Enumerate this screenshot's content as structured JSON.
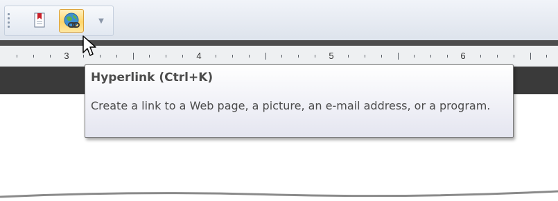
{
  "quick_access_toolbar": {
    "bookmark_button": {
      "icon": "bookmark-icon"
    },
    "hyperlink_button": {
      "icon": "hyperlink-icon",
      "state": "hover"
    },
    "customize_dropdown": {
      "icon": "chevron-down-icon"
    }
  },
  "ruler": {
    "numbers": [
      "3",
      "4",
      "5",
      "6"
    ]
  },
  "tooltip": {
    "title": "Hyperlink (Ctrl+K)",
    "description": "Create a link to a Web page, a picture, an e-mail address, or a program."
  },
  "colors": {
    "hover_accent": "#ffd66b",
    "tooltip_border": "#767676",
    "text": "#4c4c4c"
  }
}
